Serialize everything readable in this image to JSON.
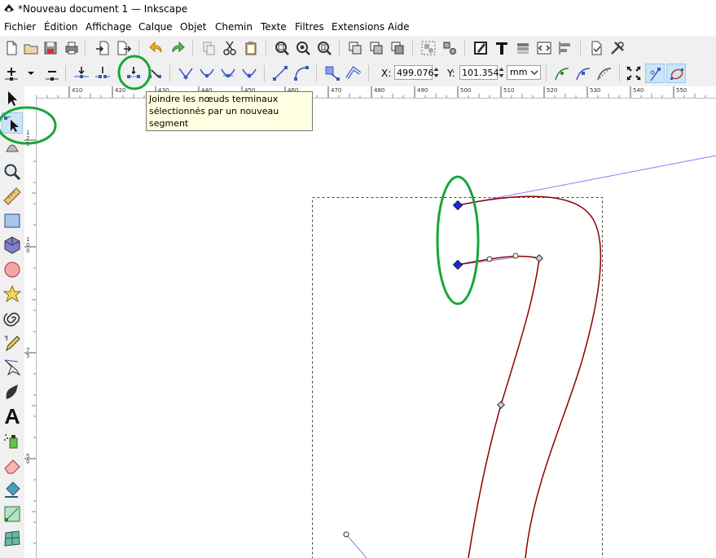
{
  "window": {
    "title": "*Nouveau document 1 — Inkscape"
  },
  "menu": [
    "Fichier",
    "Édition",
    "Affichage",
    "Calque",
    "Objet",
    "Chemin",
    "Texte",
    "Filtres",
    "Extensions",
    "Aide"
  ],
  "node_toolbar": {
    "x_label": "X:",
    "x_value": "499.076",
    "y_label": "Y:",
    "y_value": "101.354",
    "unit": "mm"
  },
  "tooltip": {
    "line1": "Joindre les nœuds terminaux",
    "line2": "sélectionnés par un nouveau segment"
  },
  "ruler_top": [
    "410",
    "420",
    "430",
    "440",
    "450",
    "460",
    "470",
    "480",
    "490",
    "500",
    "510",
    "520",
    "530",
    "540",
    "550"
  ],
  "ruler_left": [
    "1 2 5",
    "1 0 0",
    "7 5",
    "5 0"
  ],
  "colors": {
    "path_stroke": "#8b0000",
    "handle_line": "#7f7fff",
    "selected_node": "#1d2bd6",
    "annotation_circle": "#1aa53c",
    "tooltip_bg": "#ffffe1"
  }
}
